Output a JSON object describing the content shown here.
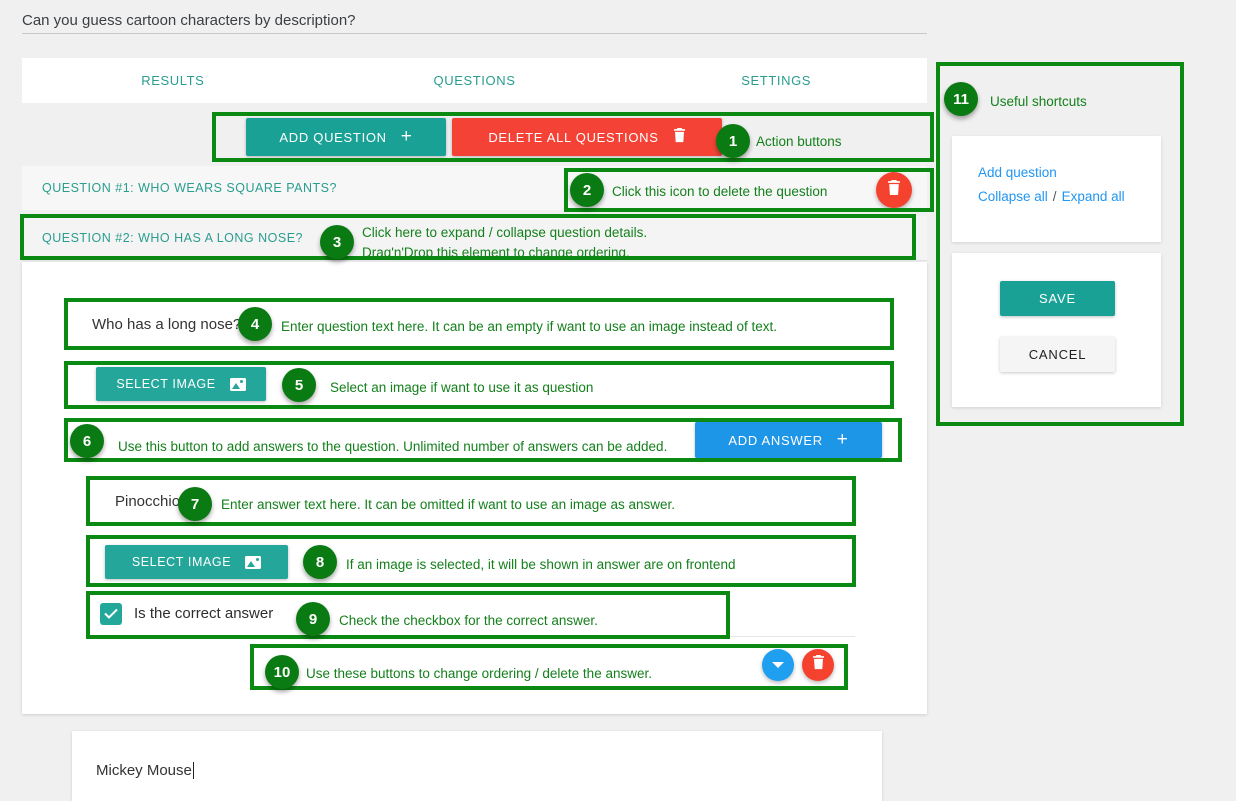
{
  "poll": {
    "title": "Can you guess cartoon characters by description?"
  },
  "tabs": [
    {
      "label": "RESULTS",
      "active": false
    },
    {
      "label": "QUESTIONS",
      "active": true
    },
    {
      "label": "SETTINGS",
      "active": false
    }
  ],
  "actions": {
    "add_question": "ADD QUESTION",
    "add_question_icon": "plus-icon",
    "delete_all_questions": "DELETE ALL QUESTIONS",
    "delete_all_icon": "trash-icon"
  },
  "questions": [
    {
      "header": "QUESTION #1: WHO WEARS SQUARE PANTS?",
      "delete_icon": "trash-icon"
    },
    {
      "header": "QUESTION #2: WHO HAS A LONG NOSE?"
    }
  ],
  "question_editor": {
    "question_text": "Who has a long nose?",
    "select_image_label": "SELECT IMAGE",
    "select_image_icon": "image-icon",
    "add_answer_label": "ADD ANSWER",
    "add_answer_icon": "plus-icon",
    "answers": [
      {
        "text": "Pinocchio",
        "select_image_label": "SELECT IMAGE",
        "select_image_icon": "image-icon",
        "correct_label": "Is the correct answer",
        "correct_checked": true,
        "move_icon": "chevron-down-icon",
        "delete_icon": "trash-icon"
      },
      {
        "text": "Mickey Mouse"
      }
    ]
  },
  "sidebar": {
    "shortcuts": {
      "add_question": "Add question",
      "collapse_all": "Collapse all",
      "separator": "/",
      "expand_all": "Expand all"
    },
    "save": "SAVE",
    "cancel": "CANCEL"
  },
  "annotations": [
    {
      "n": "1",
      "text": "Action buttons"
    },
    {
      "n": "2",
      "text": "Click this icon to delete the question"
    },
    {
      "n": "3",
      "text": "Click here to expand / collapse question details.\nDrag'n'Drop this element to change ordering."
    },
    {
      "n": "4",
      "text": "Enter question text here. It can be an empty if want to use an image instead of text."
    },
    {
      "n": "5",
      "text": "Select an image if want to use it as question"
    },
    {
      "n": "6",
      "text": "Use this button to add answers to the question. Unlimited number of answers can be added."
    },
    {
      "n": "7",
      "text": "Enter answer text here. It can be omitted if want to use an image as answer."
    },
    {
      "n": "8",
      "text": "If an image is selected, it will be shown in answer are on frontend"
    },
    {
      "n": "9",
      "text": "Check the checkbox for the correct answer."
    },
    {
      "n": "10",
      "text": "Use these buttons to change ordering / delete the answer."
    },
    {
      "n": "11",
      "text": "Useful shortcuts"
    }
  ],
  "colors": {
    "teal": "#1aa195",
    "red": "#f4422e",
    "blue": "#1e96e8",
    "annotation_green": "#0a8a12",
    "link_blue": "#2196f3"
  }
}
